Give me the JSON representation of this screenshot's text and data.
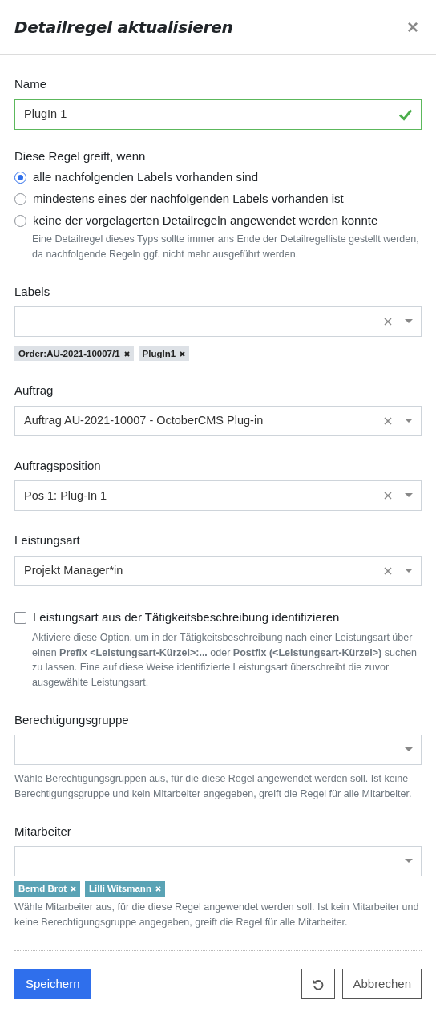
{
  "dialog": {
    "title": "Detailregel aktualisieren",
    "close": "×"
  },
  "fields": [
    {
      "kind": "text",
      "label": "Name",
      "value": "PlugIn 1",
      "valid": true
    },
    {
      "kind": "radio",
      "label": "Diese Regel greift, wenn",
      "options": [
        {
          "label": "alle nachfolgenden Labels vorhanden sind",
          "selected": true
        },
        {
          "label": "mindestens eines der nachfolgenden Labels vorhanden ist",
          "selected": false
        },
        {
          "label": "keine der vorgelagerten Detailregeln angewendet werden konnte",
          "selected": false,
          "help": "Eine Detailregel dieses Typs sollte immer ans Ende der Detailregelliste gestellt werden, da nachfolgende Regeln ggf. nicht mehr ausgeführt werden."
        }
      ]
    },
    {
      "kind": "select",
      "label": "Labels",
      "clearable": true,
      "tags": [
        {
          "text": "Order:AU-2021-10007/1",
          "color": "#dde1e6"
        },
        {
          "text": "PlugIn1",
          "color": "#dde1e6"
        }
      ]
    },
    {
      "kind": "select",
      "label": "Auftrag",
      "value": "Auftrag AU-2021-10007 - OctoberCMS Plug-in",
      "clearable": true
    },
    {
      "kind": "select",
      "label": "Auftragsposition",
      "value": "Pos 1: Plug-In 1",
      "clearable": true
    },
    {
      "kind": "select",
      "label": "Leistungsart",
      "value": "Projekt Manager*in",
      "clearable": true
    },
    {
      "kind": "checkbox",
      "label": "Leistungsart aus der Tätigkeitsbeschreibung identifizieren",
      "checked": false,
      "help": "Aktiviere diese Option, um in der Tätigkeitsbeschreibung nach einer Leistungsart über einen **Prefix <Leistungsart-Kürzel>:...** oder **Postfix (<Leistungsart-Kürzel>)** suchen zu lassen. Eine auf diese Weise identifizierte Leistungsart überschreibt die zuvor ausgewählte Leistungsart."
    },
    {
      "kind": "select",
      "label": "Berechtigungsgruppe",
      "clearable": false,
      "help": "Wähle Berechtigungsgruppen aus, für die diese Regel angewendet werden soll. Ist keine Berechtigungsgruppe und kein Mitarbeiter angegeben, greift die Regel für alle Mitarbeiter."
    },
    {
      "kind": "select",
      "label": "Mitarbeiter",
      "clearable": false,
      "tags": [
        {
          "text": "Bernd Brot",
          "color": "#5aa3b5"
        },
        {
          "text": "Lilli Witsmann",
          "color": "#5aa3b5"
        }
      ],
      "help": "Wähle Mitarbeiter aus, für die diese Regel angewendet werden soll. Ist kein Mitarbeiter und keine Berechtigungsgruppe angegeben, greift die Regel für alle Mitarbeiter."
    }
  ],
  "footer": {
    "save": "Speichern",
    "cancel": "Abbrechen"
  }
}
